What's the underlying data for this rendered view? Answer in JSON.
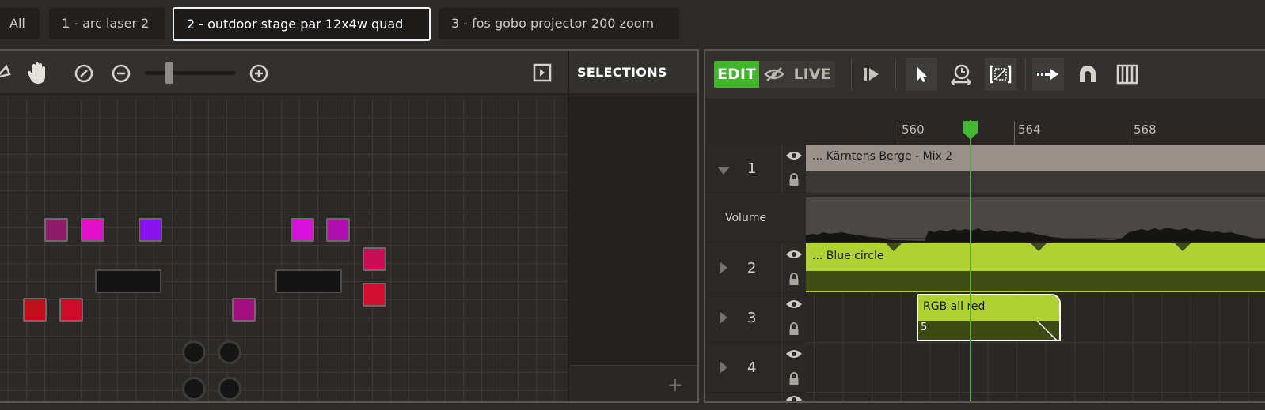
{
  "tabs": [
    {
      "label": "All"
    },
    {
      "label": "1 - arc laser 2"
    },
    {
      "label": "2 - outdoor stage par 12x4w quad"
    },
    {
      "label": "3 - fos gobo projector 200 zoom"
    }
  ],
  "left_toolbar": {
    "icons": [
      "lasso-icon",
      "hand-pan-icon",
      "zoom-reset-icon",
      "zoom-out-icon",
      "zoom-slider",
      "zoom-in-icon",
      "panel-toggle-icon"
    ],
    "zoom_level": 0.25
  },
  "selections": {
    "title": "SELECTIONS",
    "add_label": "+"
  },
  "fixtures": [
    {
      "color": "#8e1a6a"
    },
    {
      "color": "#e010c8"
    },
    {
      "color": "#8a14f0"
    },
    {
      "color": "#d810e0"
    },
    {
      "color": "#b010b0"
    },
    {
      "color": "#c80e55"
    },
    {
      "color": "#d01030"
    },
    {
      "color": "#c00e1c"
    },
    {
      "color": "#d00c2c"
    },
    {
      "color": "#a01080"
    }
  ],
  "timeline_toolbar": {
    "edit_label": "EDIT",
    "live_label": "LIVE",
    "accent": "#43b52d"
  },
  "ruler": {
    "labels": [
      "560",
      "564",
      "568"
    ]
  },
  "tracks": [
    {
      "number": "1",
      "clip_label": "... Kärntens Berge - Mix 2",
      "expanded": true
    },
    {
      "number": "2",
      "clip_label": "... Blue circle",
      "expanded": false
    },
    {
      "number": "3",
      "clip_label": "RGB all red",
      "clip_value": "5",
      "expanded": false
    },
    {
      "number": "4",
      "expanded": false
    }
  ],
  "volume_label": "Volume",
  "colors": {
    "clip_green": "#afd132",
    "audio_clip": "#989089",
    "playhead": "#45b832"
  }
}
